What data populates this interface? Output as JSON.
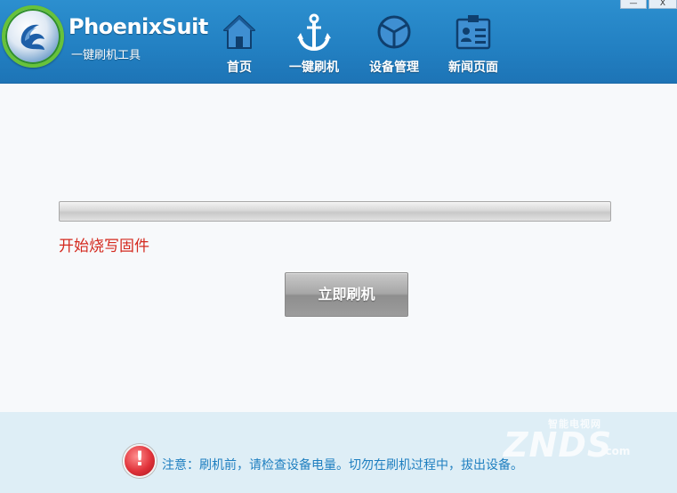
{
  "app": {
    "title": "PhoenixSuit",
    "subtitle": "一键刷机工具"
  },
  "window_controls": {
    "minimize_label": "—",
    "close_label": "X"
  },
  "nav": {
    "items": [
      {
        "label": "首页",
        "icon": "home-icon"
      },
      {
        "label": "一键刷机",
        "icon": "anchor-icon"
      },
      {
        "label": "设备管理",
        "icon": "device-cube-icon"
      },
      {
        "label": "新闻页面",
        "icon": "news-badge-icon"
      }
    ]
  },
  "main": {
    "progress": 0,
    "status": "开始烧写固件",
    "flash_button_label": "立即刷机"
  },
  "footer": {
    "notice": "注意：刷机前，请检查设备电量。切勿在刷机过程中，拔出设备。"
  },
  "watermark": {
    "small_text": "智能电视网",
    "brand": "ZNDS",
    "domain": ".com"
  },
  "colors": {
    "header": "#2381c3",
    "status_text": "#d42a1f",
    "notice_text": "#1f7fc0",
    "footer_bg": "#deeef6"
  }
}
